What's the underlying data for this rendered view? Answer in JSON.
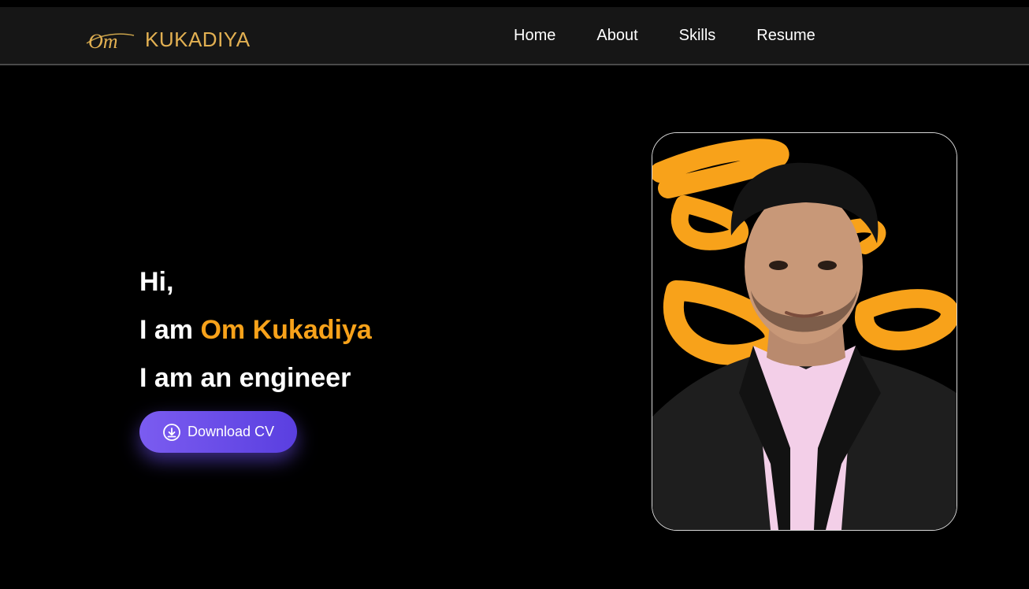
{
  "brand": {
    "mark": "Om",
    "name": "KUKADIYA"
  },
  "nav": {
    "items": [
      {
        "label": "Home"
      },
      {
        "label": "About"
      },
      {
        "label": "Skills"
      },
      {
        "label": "Resume"
      }
    ]
  },
  "hero": {
    "greeting": "Hi,",
    "intro_prefix": "I am ",
    "name": "Om Kukadiya",
    "role_line": "I am an engineer",
    "download_label": "Download CV",
    "download_icon": "cloud-download-icon"
  },
  "profile": {
    "image": "profile-photo"
  },
  "colors": {
    "accent": "#f8a21a",
    "brand_gold": "#e2b052",
    "button_start": "#7b5cf0",
    "button_end": "#5a3fe0",
    "navbar_bg": "#161616",
    "page_bg": "#000000"
  }
}
